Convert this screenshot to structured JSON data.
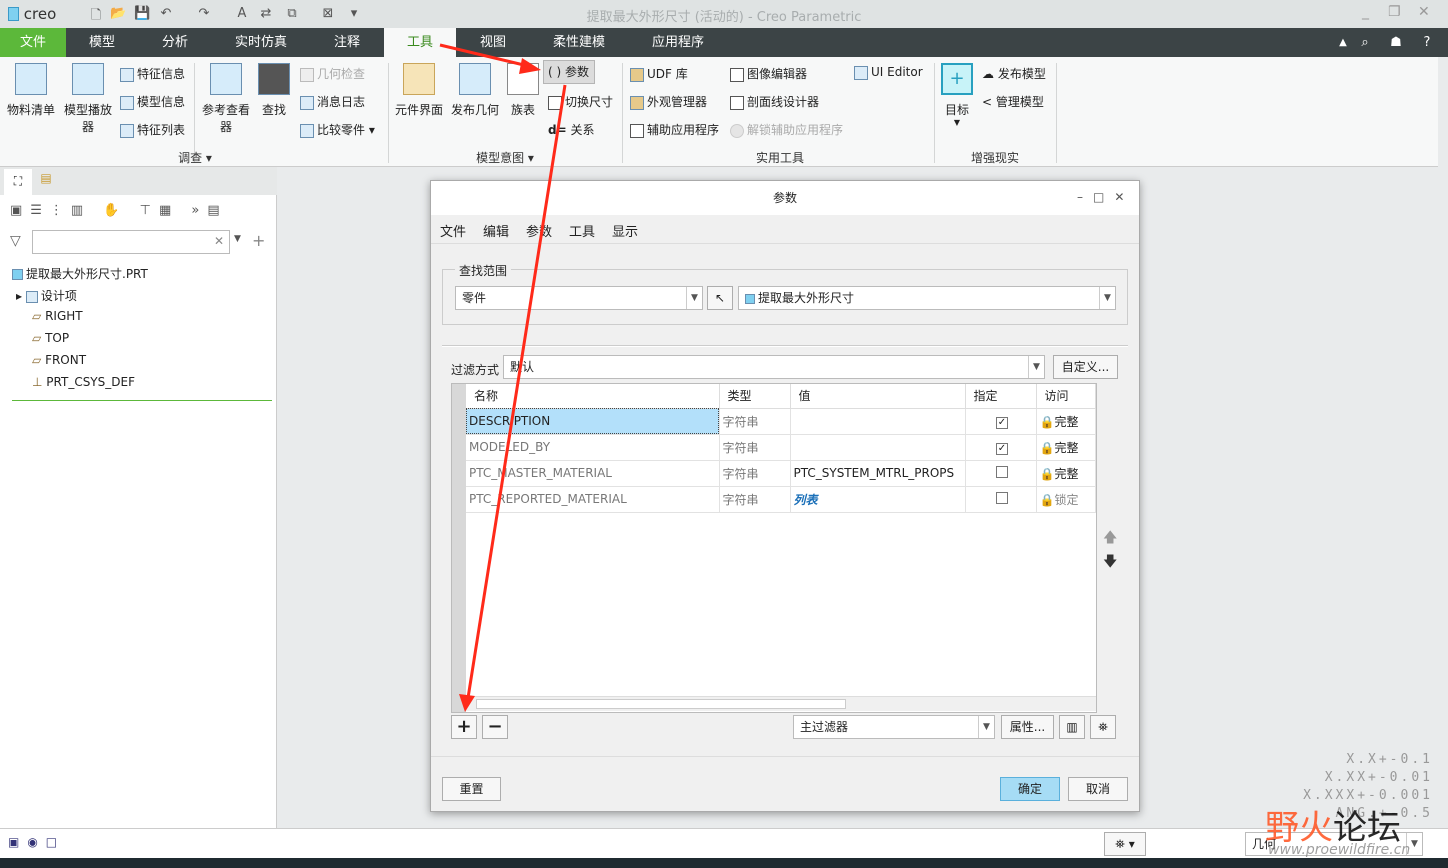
{
  "window": {
    "app_logo": "creo",
    "title": "提取最大外形尺寸 (活动的) - Creo Parametric",
    "minimize": "_",
    "restore": "❐",
    "close": "✕"
  },
  "quick_access": [
    "new-icon",
    "open-icon",
    "save-icon",
    "undo-icon",
    "redo-icon",
    "text-icon",
    "regenerate-icon",
    "window-icon",
    "close-window-icon",
    "customize-icon"
  ],
  "tabs": [
    "文件",
    "模型",
    "分析",
    "实时仿真",
    "注释",
    "工具",
    "视图",
    "柔性建模",
    "应用程序"
  ],
  "active_tab": "工具",
  "ribbon_right": {
    "minimize": "▲",
    "search": "⌕",
    "hat": "☗",
    "help": "?"
  },
  "ribbon": {
    "investigate": {
      "label": "调查 ▾",
      "bom": "物料清单",
      "model_player": "模型播放器",
      "feature_info": "特征信息",
      "model_info": "模型信息",
      "feature_list": "特征列表",
      "ref_viewer": "参考查看器",
      "find": "查找",
      "geom_check": "几何检查",
      "message_log": "消息日志",
      "compare_part": "比较零件"
    },
    "model_intent": {
      "label": "模型意图 ▾",
      "component_interface": "元件界面",
      "publish_geom": "发布几何",
      "family_table": "族表",
      "parameters": "参数",
      "switch_dims": "切换尺寸",
      "relations": "关系"
    },
    "utilities": {
      "label": "实用工具",
      "udf": "UDF 库",
      "appearance": "外观管理器",
      "aux_app": "辅助应用程序",
      "image_editor": "图像编辑器",
      "xhatch": "剖面线设计器",
      "unlock_aux": "解锁辅助应用程序",
      "ui_editor": "UI Editor"
    },
    "ar": {
      "label": "增强现实",
      "target": "目标",
      "publish_model": "发布模型",
      "manage_model": "管理模型"
    }
  },
  "model_tree": {
    "search_placeholder": "",
    "root": "提取最大外形尺寸.PRT",
    "items": [
      "设计项",
      "RIGHT",
      "TOP",
      "FRONT",
      "PRT_CSYS_DEF"
    ]
  },
  "dialog": {
    "title": "参数",
    "menu": [
      "文件",
      "编辑",
      "参数",
      "工具",
      "显示"
    ],
    "scope_label": "查找范围",
    "scope_type": "零件",
    "scope_object": "提取最大外形尺寸",
    "filter_label": "过滤方式",
    "filter_value": "默认",
    "customize": "自定义...",
    "columns": [
      "名称",
      "类型",
      "值",
      "指定",
      "访问"
    ],
    "rows": [
      {
        "name": "DESCRIPTION",
        "type": "字符串",
        "value": "",
        "designated": true,
        "access": "完整"
      },
      {
        "name": "MODELED_BY",
        "type": "字符串",
        "value": "",
        "designated": true,
        "access": "完整"
      },
      {
        "name": "PTC_MASTER_MATERIAL",
        "type": "字符串",
        "value": "PTC_SYSTEM_MTRL_PROPS",
        "designated": false,
        "access": "完整"
      },
      {
        "name": "PTC_REPORTED_MATERIAL",
        "type": "字符串",
        "value": "列表",
        "designated": false,
        "access": "锁定"
      }
    ],
    "add": "+",
    "remove": "−",
    "main_filter": "主过滤器",
    "properties": "属性...",
    "reset": "重置",
    "ok": "确定",
    "cancel": "取消"
  },
  "tolerances": [
    "X.X+-0.1",
    "X.XX+-0.01",
    "X.XXX+-0.001",
    "ANG.+-0.5"
  ],
  "status": {
    "selection_filter": "几何"
  },
  "watermark": {
    "text": "野火论坛",
    "url": "www.proewildfire.cn"
  },
  "colors": {
    "file_tab": "#5cb83a",
    "tab_bar": "#3c4446",
    "selection": "#b3e0fa",
    "ok_button": "#a6dcf5",
    "arrow": "#ff2a1a"
  }
}
